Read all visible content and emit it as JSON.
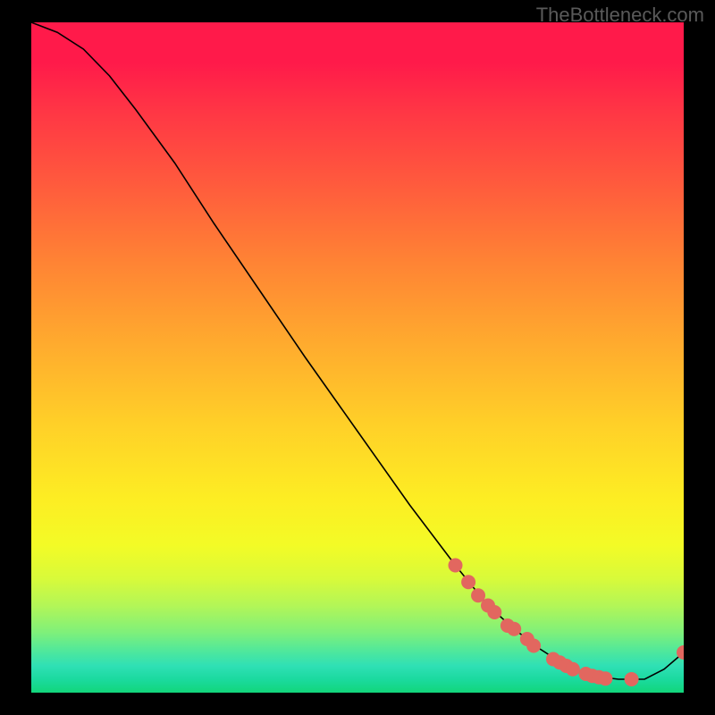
{
  "attribution": "TheBottleneck.com",
  "chart_data": {
    "type": "line",
    "title": "",
    "xlabel": "",
    "ylabel": "",
    "xlim": [
      0,
      100
    ],
    "ylim": [
      0,
      100
    ],
    "curve": {
      "x": [
        0,
        4,
        8,
        12,
        16,
        22,
        28,
        35,
        42,
        50,
        58,
        65,
        70,
        74,
        78,
        82,
        86,
        90,
        94,
        97,
        100
      ],
      "y": [
        100,
        98.5,
        96,
        92,
        87,
        79,
        70,
        60,
        50,
        39,
        28,
        19,
        13,
        9.5,
        6.5,
        4,
        2.5,
        2,
        2,
        3.5,
        6
      ]
    },
    "markers": [
      {
        "x": 65,
        "y": 19
      },
      {
        "x": 67,
        "y": 16.5
      },
      {
        "x": 68.5,
        "y": 14.5
      },
      {
        "x": 70,
        "y": 13
      },
      {
        "x": 71,
        "y": 12
      },
      {
        "x": 73,
        "y": 10
      },
      {
        "x": 74,
        "y": 9.5
      },
      {
        "x": 76,
        "y": 8
      },
      {
        "x": 77,
        "y": 7
      },
      {
        "x": 80,
        "y": 5
      },
      {
        "x": 81,
        "y": 4.5
      },
      {
        "x": 82,
        "y": 4
      },
      {
        "x": 83,
        "y": 3.5
      },
      {
        "x": 85,
        "y": 2.8
      },
      {
        "x": 86,
        "y": 2.5
      },
      {
        "x": 87,
        "y": 2.3
      },
      {
        "x": 88,
        "y": 2.1
      },
      {
        "x": 92,
        "y": 2
      },
      {
        "x": 100,
        "y": 6
      }
    ],
    "marker_color": "#e2675f",
    "line_color": "#000000"
  }
}
